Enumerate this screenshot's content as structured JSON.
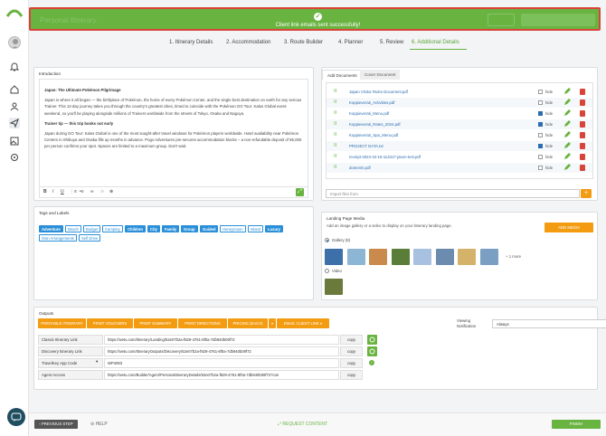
{
  "header": {
    "ghost_title": "Personal Itinerary",
    "toast_message": "Client link emails sent successfully!"
  },
  "steps": [
    {
      "label": "1. Itinerary Details"
    },
    {
      "label": "2. Accommodation"
    },
    {
      "label": "3. Route Builder"
    },
    {
      "label": "4. Planner"
    },
    {
      "label": "5. Review"
    },
    {
      "label": "6. Additional Details"
    }
  ],
  "intro": {
    "title": "Introduction",
    "heading": "Japan: The Ultimate Pokémon Pilgrimage",
    "para1": "Japan is where it all began — the birthplace of Pokémon, the home of every Pokémon Center, and the single best destination on earth for any serious Trainer. This 12-day journey takes you through the country's greatest cities, timed to coincide with the Pokémon GO Tour: Kalos Global event weekend, so you'll be playing alongside millions of Trainers worldwide from the streets of Tokyo, Osaka and Nagoya.",
    "subheading": "Trainer tip — this trip books out early",
    "para2": "Japan during GO Tour: Kalos Global is one of the most sought-after travel windows for Pokémon players worldwide. Hotel availability near Pokémon Centers in Shibuya and Osaka fills up months in advance. Pogo Adventures pre-secures accommodation blocks – a non-refundable deposit of ¥5,000 per person confirms your spot. Spaces are limited to a maximum group. Don't wait."
  },
  "documents": {
    "tab_add": "Add Documents",
    "tab_cover": "Cover Document",
    "hide_label": "hide",
    "files": [
      {
        "name": "Japan Visitor Rules Document.pdf",
        "hidden": false
      },
      {
        "name": "Koppieverati_Activities.pdf",
        "hidden": false
      },
      {
        "name": "Koppieverati_Menu.pdf",
        "hidden": true
      },
      {
        "name": "Koppieverati_Rates_2024.pdf",
        "hidden": true
      },
      {
        "name": "Koppieverati_Spa_Menu.pdf",
        "hidden": false
      },
      {
        "name": "PROJECT DATA.txt",
        "hidden": true
      },
      {
        "name": "receipt-2024-10-15-113417-jason-test.pdf",
        "hidden": false
      },
      {
        "name": "doments.pdf",
        "hidden": false
      }
    ],
    "import_placeholder": "Import files from"
  },
  "tags": {
    "title": "Tags and Labels",
    "items": [
      {
        "label": "Adventure",
        "selected": true
      },
      {
        "label": "Beach",
        "selected": false
      },
      {
        "label": "Budget",
        "selected": false
      },
      {
        "label": "Camping",
        "selected": false
      },
      {
        "label": "Children",
        "selected": true
      },
      {
        "label": "City",
        "selected": true
      },
      {
        "label": "Family",
        "selected": true
      },
      {
        "label": "Group",
        "selected": true
      },
      {
        "label": "Guided",
        "selected": true
      },
      {
        "label": "Honeymoon",
        "selected": false
      },
      {
        "label": "Island",
        "selected": false
      },
      {
        "label": "Luxury",
        "selected": true
      },
      {
        "label": "Own Arrangements",
        "selected": false
      },
      {
        "label": "Self Drive",
        "selected": false
      }
    ]
  },
  "media": {
    "title": "Landing Page Media",
    "description": "Add an image gallery or a video to display on your itinerary landing page.",
    "add_button": "ADD MEDIA",
    "gallery_label": "Gallery (8)",
    "video_label": "Video",
    "more_label": "+ 1 more",
    "thumb_colors": [
      "#3d6fa8",
      "#8db6d4",
      "#c98a4b",
      "#5a7d3a",
      "#a8c1e0",
      "#6b8cae",
      "#d4b26a",
      "#7a9fc2"
    ]
  },
  "outputs": {
    "title": "Outputs",
    "buttons": [
      {
        "label": "PRINTABLE ITINERARY"
      },
      {
        "label": "PRINT VOUCHERS"
      },
      {
        "label": "PRINT SUMMARY"
      },
      {
        "label": "PRINT DIRECTIONS"
      },
      {
        "label": "PRICING (EACH)"
      },
      {
        "label": "▾"
      },
      {
        "label": "EMAIL CLIENT LINK  ▾"
      }
    ],
    "viewing_label_1": "Viewing",
    "viewing_label_2": "Notification",
    "viewing_value": "Always",
    "rows": [
      {
        "label": "Classic Itinerary Link",
        "url": "https://wetu.com/Itinerary/Landing/52e07b2a-f829-4761-8f0a-7db940b09f72",
        "copy": "copy"
      },
      {
        "label": "Discovery Itinerary Link",
        "url": "https://wetu.com/ItineraryOutputs/Discovery/52e07b2a-f829-4761-8f0a-7db940b09f72",
        "copy": "copy"
      },
      {
        "label": "TravelKey App Code",
        "url": "WP4083",
        "copy": "copy"
      },
      {
        "label": "Agent Access",
        "url": "https://wetu.com/Builder/Agent/PersonalItineraryDetails/52e07b2a-f829-4761-8f0a-7db940b09f72?con",
        "copy": "copy"
      }
    ]
  },
  "footer": {
    "prev": "‹ PREVIOUS STEP",
    "help": "HELP",
    "request": "⤢ REQUEST CONTENT",
    "finish": "FINISH"
  },
  "colors": {
    "accent_green": "#69b341",
    "accent_orange": "#f39c12",
    "tag_blue": "#2b8fd9",
    "alert_border": "#d9443a"
  }
}
